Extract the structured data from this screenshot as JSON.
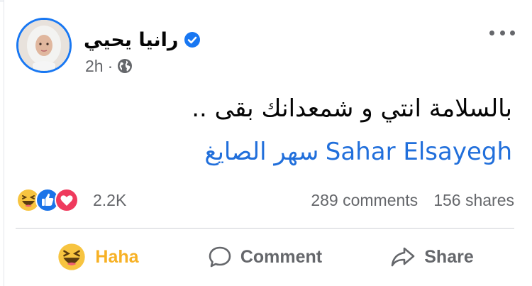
{
  "post": {
    "author": "رانيا يحيي",
    "time": "2h",
    "separator": "·",
    "text": "بالسلامة انتي و شمعدانك بقى ..",
    "mention_latin": "Sahar Elsayegh",
    "mention_arabic": "سهر الصايغ"
  },
  "stats": {
    "reactions_count": "2.2K",
    "comments": "289 comments",
    "shares": "156 shares"
  },
  "actions": {
    "haha": "Haha",
    "comment": "Comment",
    "share": "Share"
  },
  "colors": {
    "link": "#216fdb",
    "verified": "#1877f2",
    "haha": "#f7b125",
    "secondary_text": "#65676b"
  },
  "icons": [
    "verified-icon",
    "globe-icon",
    "more-options-icon",
    "haha-reaction-icon",
    "like-reaction-icon",
    "love-reaction-icon",
    "comment-icon",
    "share-icon"
  ]
}
